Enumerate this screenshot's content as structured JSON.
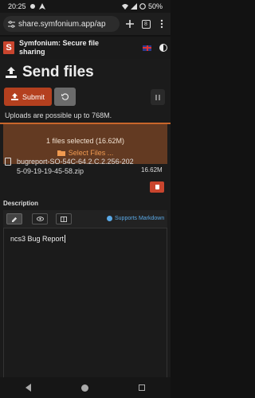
{
  "status_bar": {
    "time": "20:25",
    "battery": "50%"
  },
  "browser": {
    "url": "share.symfonium.app/ap",
    "tab_count": "8"
  },
  "app": {
    "title": "Symfonium: Secure file sharing",
    "logo_letter": "S"
  },
  "page": {
    "title": "Send files",
    "submit_label": "Submit",
    "upload_info": "Uploads are possible up to 768M.",
    "selected_text": "1 files selected (16.62M)",
    "select_files_label": "Select Files ...",
    "file": {
      "name": "bugreport-SO-54C-64.2.C.2.256-2025-09-19-19-45-58.zip",
      "size": "16.62M"
    },
    "description_label": "Description",
    "markdown_support": "Supports Markdown",
    "description_value": "ncs3 Bug Report"
  },
  "colors": {
    "accent": "#c9452e",
    "dropzone": "#633a22",
    "link": "#5aa9e6"
  }
}
